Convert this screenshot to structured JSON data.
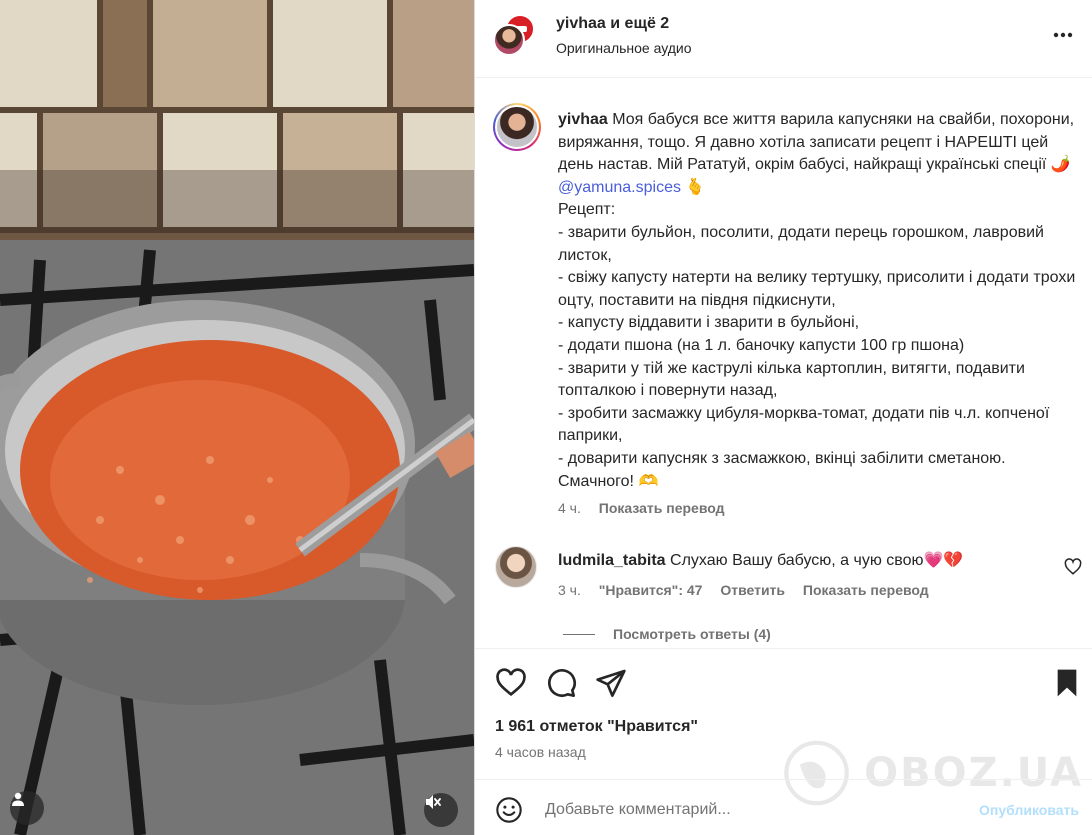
{
  "header": {
    "username": "yivhaa",
    "coauthors": "и ещё 2",
    "audio": "Оригинальное аудио",
    "more_icon": "more-horizontal-icon"
  },
  "caption": {
    "username": "yivhaa",
    "lines": [
      "Моя бабуся все життя варила капусняки на свайби, похорони, виряжання, тощо. Я давно хотіла записати рецепт і НАРЕШТІ цей день настав. Мій Рататуй, окрім бабусі, найкращі українські спеції 🌶️",
      "Рецепт:",
      "- зварити бульйон, посолити, додати перець горошком, лавровий листок,",
      "- свіжу капусту натерти на велику тертушку, присолити і додати трохи оцту, поставити на півдня підкиснути,",
      "- капусту віддавити і зварити в бульйоні,",
      "- додати пшона (на 1 л. баночку капусти 100 гр пшона)",
      "- зварити у тій же каструлі кілька картоплин, витягти, подавити топталкою і повернути назад,",
      "- зробити засмажку цибуля-морква-томат, додати пів ч.л. копченої паприки,",
      "- доварити капусняк з засмажкою, вкінці забілити сметаною. Смачного! 🫶"
    ],
    "mention": "@yamuna.spices",
    "mention_suffix": "🫰",
    "time": "4 ч.",
    "translate": "Показать перевод"
  },
  "comment": {
    "username": "ludmila_tabita",
    "text": "Слухаю Вашу бабусю, а чую свою💗💔",
    "time": "3 ч.",
    "likes": "\"Нравится\": 47",
    "reply": "Ответить",
    "translate": "Показать перевод",
    "view_replies": "Посмотреть ответы (4)"
  },
  "actions": {
    "like_icon": "heart-icon",
    "comment_icon": "comment-icon",
    "share_icon": "send-icon",
    "save_icon": "bookmark-icon"
  },
  "post": {
    "likes_count": "1 961 отметок \"Нравится\"",
    "time_ago": "4 часов назад"
  },
  "composer": {
    "placeholder": "Добавьте комментарий...",
    "publish": "Опубликовать"
  },
  "watermark": {
    "text": "OBOZ.UA"
  },
  "colors": {
    "accent": "#0095f6",
    "mention": "#4a5ed8",
    "muted": "#737373"
  }
}
